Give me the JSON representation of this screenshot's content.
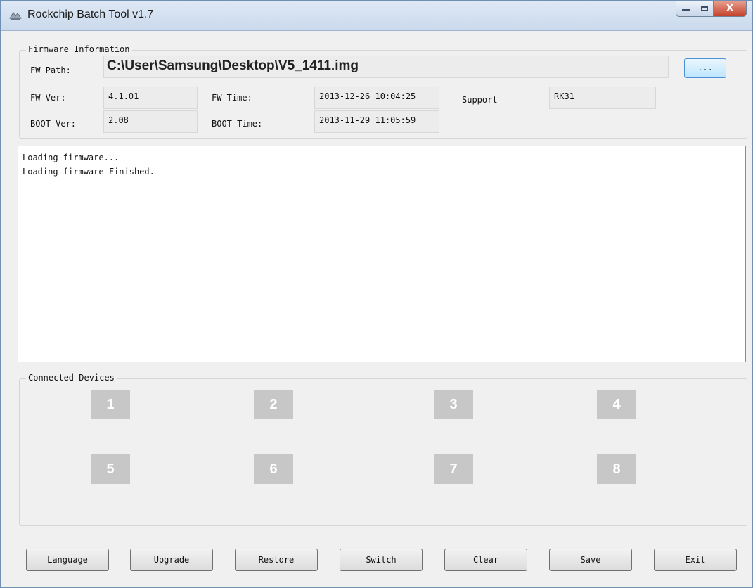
{
  "window": {
    "title": "Rockchip Batch Tool v1.7",
    "close_glyph": "X"
  },
  "firmware": {
    "legend": "Firmware Information",
    "fw_path_label": "FW Path:",
    "fw_path_value": "C:\\User\\Samsung\\Desktop\\V5_1411.img",
    "browse_label": "...",
    "fw_ver_label": "FW Ver:",
    "fw_ver_value": "4.1.01",
    "fw_time_label": "FW Time:",
    "fw_time_value": "2013-12-26 10:04:25",
    "support_label": "Support",
    "support_value": "RK31",
    "boot_ver_label": "BOOT Ver:",
    "boot_ver_value": "2.08",
    "boot_time_label": "BOOT Time:",
    "boot_time_value": "2013-11-29 11:05:59"
  },
  "log": {
    "lines": [
      "Loading firmware...",
      "Loading firmware Finished."
    ]
  },
  "devices": {
    "legend": "Connected Devices",
    "slots": [
      "1",
      "2",
      "3",
      "4",
      "5",
      "6",
      "7",
      "8"
    ]
  },
  "buttons": {
    "language": "Language",
    "upgrade": "Upgrade",
    "restore": "Restore",
    "switch": "Switch",
    "clear": "Clear",
    "save": "Save",
    "exit": "Exit"
  },
  "colors": {
    "device_slot": "#c7c7c7",
    "close_button": "#c4422b",
    "titlebar": "#c9d9ec"
  }
}
